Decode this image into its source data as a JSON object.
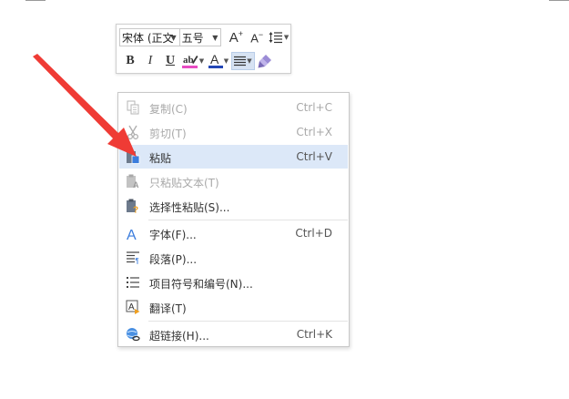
{
  "toolbar": {
    "font_name": "宋体 (正文",
    "font_size": "五号",
    "bold": "B",
    "italic": "I",
    "underline": "U",
    "grow_font": "A",
    "shrink_font": "A",
    "highlight_color": "#e84cc3",
    "font_color": "#2346b6"
  },
  "menu": {
    "items": [
      {
        "label": "复制(C)",
        "shortcut": "Ctrl+C",
        "icon": "copy-icon",
        "disabled": true
      },
      {
        "label": "剪切(T)",
        "shortcut": "Ctrl+X",
        "icon": "scissors-icon",
        "disabled": true
      },
      {
        "label": "粘贴",
        "shortcut": "Ctrl+V",
        "icon": "paste-icon",
        "disabled": false
      },
      {
        "label": "只粘贴文本(T)",
        "shortcut": "",
        "icon": "paste-text-icon",
        "disabled": true
      },
      {
        "label": "选择性粘贴(S)...",
        "shortcut": "",
        "icon": "paste-special-icon",
        "disabled": false
      },
      {
        "label": "字体(F)...",
        "shortcut": "Ctrl+D",
        "icon": "font-icon",
        "disabled": false
      },
      {
        "label": "段落(P)...",
        "shortcut": "",
        "icon": "paragraph-icon",
        "disabled": false
      },
      {
        "label": "项目符号和编号(N)...",
        "shortcut": "",
        "icon": "list-icon",
        "disabled": false
      },
      {
        "label": "翻译(T)",
        "shortcut": "",
        "icon": "translate-icon",
        "disabled": false
      },
      {
        "label": "超链接(H)...",
        "shortcut": "Ctrl+K",
        "icon": "hyperlink-icon",
        "disabled": false
      }
    ]
  },
  "colors": {
    "arrow": "#ef3b35",
    "hover": "#dce8f8",
    "accent_blue": "#3b7ddd"
  }
}
